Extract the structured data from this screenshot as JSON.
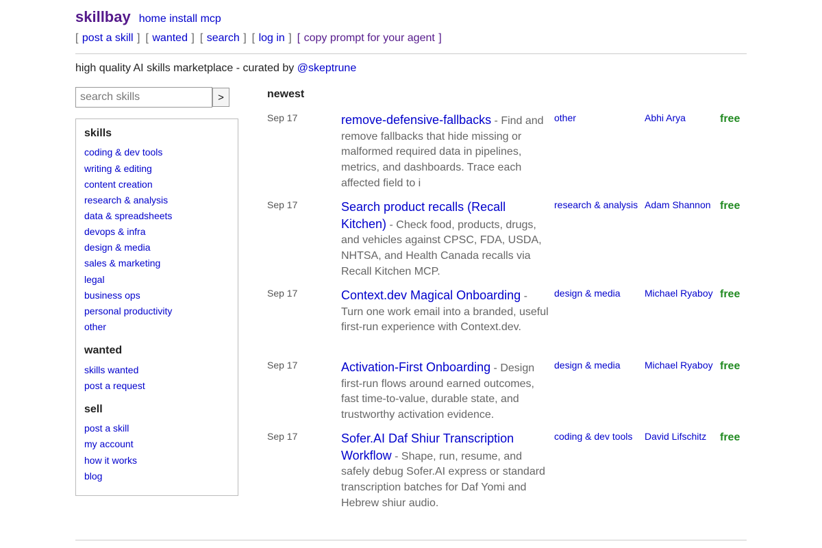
{
  "header": {
    "logo": "skillbay",
    "links": [
      "home",
      "install",
      "mcp"
    ]
  },
  "nav": {
    "post_skill": "post a skill",
    "wanted": "wanted",
    "search": "search",
    "login": "log in",
    "copy_prompt": "copy prompt for your agent"
  },
  "tagline": {
    "text": "high quality AI skills marketplace - curated by ",
    "handle": "@skeptrune"
  },
  "search": {
    "placeholder": "search skills",
    "button": ">"
  },
  "sidebar": {
    "skills_heading": "skills",
    "skills": [
      "coding & dev tools",
      "writing & editing",
      "content creation",
      "research & analysis",
      "data & spreadsheets",
      "devops & infra",
      "design & media",
      "sales & marketing",
      "legal",
      "business ops",
      "personal productivity",
      "other"
    ],
    "wanted_heading": "wanted",
    "wanted": [
      "skills wanted",
      "post a request"
    ],
    "sell_heading": "sell",
    "sell": [
      "post a skill",
      "my account",
      "how it works",
      "blog"
    ]
  },
  "listing": {
    "heading": "newest",
    "rows": [
      {
        "date": "Sep 17",
        "title": "remove-defensive-fallbacks",
        "summary": " - Find and remove fallbacks that hide missing or malformed required data in pipelines, metrics, and dashboards. Trace each affected field to i",
        "category": "other",
        "author": "Abhi Arya",
        "price": "free"
      },
      {
        "date": "Sep 17",
        "title": "Search product recalls (Recall Kitchen)",
        "summary": " - Check food, products, drugs, and vehicles against CPSC, FDA, USDA, NHTSA, and Health Canada recalls via Recall Kitchen MCP.",
        "category": "research & analysis",
        "author": "Adam Shannon",
        "price": "free"
      },
      {
        "date": "Sep 17",
        "title": "Context.dev Magical Onboarding",
        "summary": " - Turn one work email into a branded, useful first-run experience with Context.dev.",
        "category": "design & media",
        "author": "Michael Ryaboy",
        "price": "free"
      },
      {
        "date": "Sep 17",
        "title": "Activation-First Onboarding",
        "summary": " - Design first-run flows around earned outcomes, fast time-to-value, durable state, and trustworthy activation evidence.",
        "category": "design & media",
        "author": "Michael Ryaboy",
        "price": "free"
      },
      {
        "date": "Sep 17",
        "title": "Sofer.AI Daf Shiur Transcription Workflow",
        "summary": " - Shape, run, resume, and safely debug Sofer.AI express or standard transcription batches for Daf Yomi and Hebrew shiur audio.",
        "category": "coding & dev tools",
        "author": "David Lifschitz",
        "price": "free"
      }
    ]
  },
  "colors": {
    "link": "#0000cc",
    "logo": "#551a8b",
    "price": "#228b22",
    "text_muted": "#666666"
  }
}
